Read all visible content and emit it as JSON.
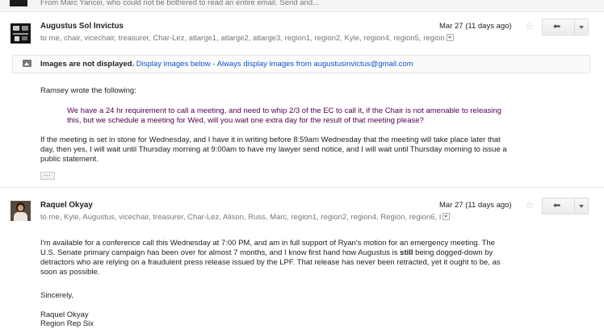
{
  "collapsed_message": {
    "snippet": "From Marc Yancei, who could not be bothered to read an entire email. Send and..."
  },
  "message1": {
    "sender": "Augustus Sol Invictus",
    "recipients": "to me, chair, vicechair, treasurer, Char-Lez, atlarge1, atlarge2, atlarge3, region1, region2, Kyle, region4, region5, region",
    "date": "Mar 27 (11 days ago)",
    "images_banner": {
      "title": "Images are not displayed.",
      "display_below": "Display images below",
      "separator": " - ",
      "always_display": "Always display images from augustusinvictus@gmail.com"
    },
    "intro": "Ramsey wrote the following:",
    "quote_line1": "We have a 24 hr requirement to call a meeting, and need to whip 2/3 of the EC to call it, if the Chair is not amenable to releasing",
    "quote_line2": "this, but we schedule a meeting for Wed, will you wait one extra day for the result of that meeting please?",
    "body_line1": "If the meeting is set in stone for Wednesday, and I have it in writing before 8:59am Wednesday that the meeting will take place later that",
    "body_line2": "day, then yes, I will wait until Thursday morning at 9:00am to have my lawyer send notice, and I will wait until Thursday morning to issue a",
    "body_line3": "public statement.",
    "ellipsis": "..."
  },
  "message2": {
    "sender": "Raquel Okyay",
    "recipients": "to me, Kyle, Augustus, vicechair, treasurer, Char-Lez, Alison, Russ, Marc, region1, region2, region4, Region, region6, I",
    "date": "Mar 27 (11 days ago)",
    "para1_line1": "I'm available for a conference call this Wednesday at 7:00 PM, and am in full support of Ryan's motion for an emergency meeting. The",
    "para1_line2a": "U.S. Senate primary campaign has been over for almost 7 months, and I know first hand how Augustus is ",
    "para1_line2_bold": "still",
    "para1_line2b": " being dogged-down by",
    "para1_line3": "detractors who are relying on a fraudulent press release issued by the LPF. That release has never been retracted, yet it ought to be, as",
    "para1_line4": "soon as possible.",
    "closing": "Sincerely,",
    "signature_name": "Raquel Okyay",
    "signature_title": "Region Rep Six"
  },
  "icons": {
    "star": "☆",
    "reply": "🡸",
    "reply_glyph": "⬅"
  }
}
